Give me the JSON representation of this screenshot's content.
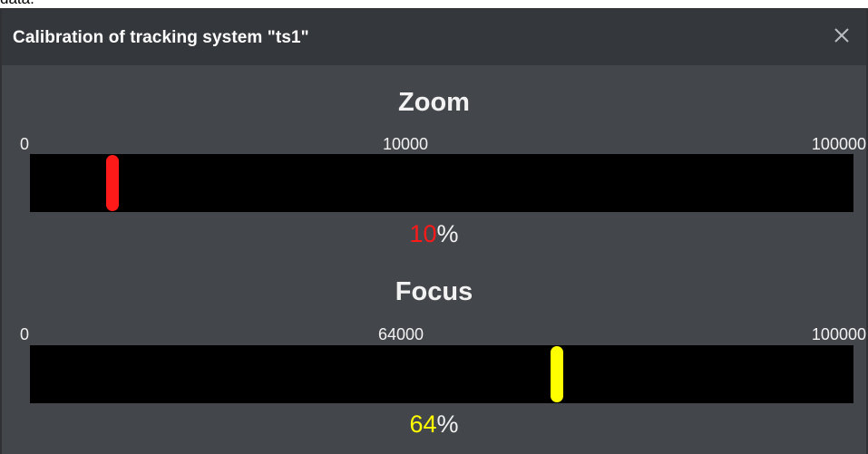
{
  "page_fragment": "data.",
  "dialog": {
    "title": "Calibration of tracking system \"ts1\"",
    "close_icon": "close-icon"
  },
  "zoom": {
    "title": "Zoom",
    "tick_min": "0",
    "tick_mid": "10000",
    "tick_max": "100000",
    "value_percent": 10,
    "value_text": "10",
    "sign": "%",
    "color": "#ff1a1a"
  },
  "focus": {
    "title": "Focus",
    "tick_min": "0",
    "tick_mid": "64000",
    "tick_max": "100000",
    "value_percent": 64,
    "value_text": "64",
    "sign": "%",
    "color": "#ffff00"
  }
}
